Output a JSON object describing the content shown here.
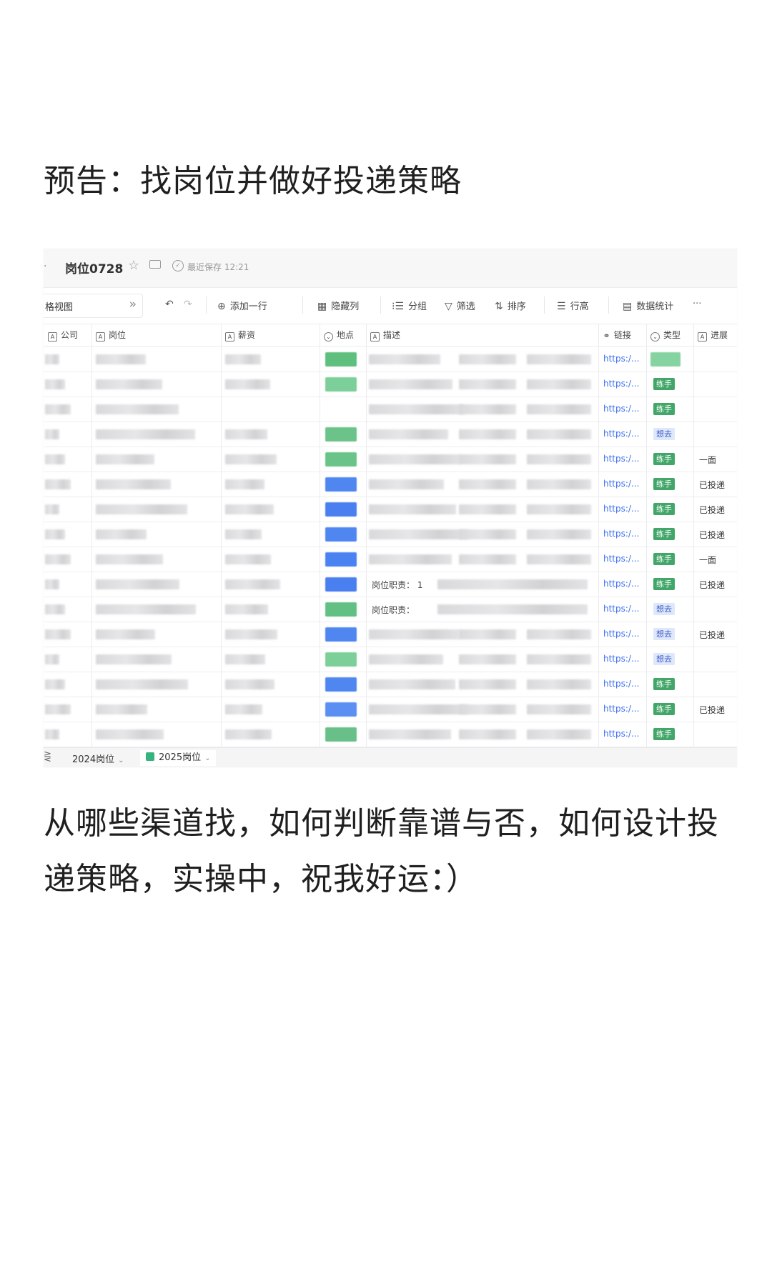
{
  "post": {
    "heading": "预告：找岗位并做好投递策略",
    "body": "从哪些渠道找，如何判断靠谱与否，如何设计投递策略，实操中，祝我好运：）"
  },
  "app": {
    "breadcrumb_arrow": "·",
    "doc_title": "岗位0728",
    "save_status": "最近保存 12:21",
    "view_name": "格视图",
    "toolbar": {
      "add_row": "添加一行",
      "hide_columns": "隐藏列",
      "group": "分组",
      "filter": "筛选",
      "sort": "排序",
      "row_height": "行高",
      "stats": "数据统计",
      "more": "···"
    },
    "columns": [
      "公司",
      "岗位",
      "薪资",
      "地点",
      "描述",
      "链接",
      "类型",
      "进展"
    ],
    "rows": [
      {
        "link": "https:/...",
        "type": "",
        "progress": ""
      },
      {
        "link": "https:/...",
        "type": "练手",
        "progress": ""
      },
      {
        "link": "https:/...",
        "type": "练手",
        "progress": ""
      },
      {
        "link": "https:/...",
        "type": "想去",
        "progress": ""
      },
      {
        "link": "https:/...",
        "type": "练手",
        "progress": "一面"
      },
      {
        "link": "https:/...",
        "type": "练手",
        "progress": "已投递"
      },
      {
        "link": "https:/...",
        "type": "练手",
        "progress": "已投递"
      },
      {
        "link": "https:/...",
        "type": "练手",
        "progress": "已投递"
      },
      {
        "link": "https:/...",
        "type": "练手",
        "progress": "一面"
      },
      {
        "link": "https:/...",
        "type": "练手",
        "progress": "已投递",
        "desc": "岗位职责：  1"
      },
      {
        "link": "https:/...",
        "type": "想去",
        "progress": "",
        "desc": "岗位职责："
      },
      {
        "link": "https:/...",
        "type": "想去",
        "progress": "已投递"
      },
      {
        "link": "https:/...",
        "type": "想去",
        "progress": ""
      },
      {
        "link": "https:/...",
        "type": "练手",
        "progress": ""
      },
      {
        "link": "https:/...",
        "type": "练手",
        "progress": "已投递"
      },
      {
        "link": "https:/...",
        "type": "练手",
        "progress": ""
      }
    ],
    "sheets": [
      "2024岗位",
      "2025岗位"
    ],
    "colors": {
      "tag_practice": "#41a668",
      "tag_want": "#dfe7fb",
      "link": "#3a6df0"
    }
  }
}
